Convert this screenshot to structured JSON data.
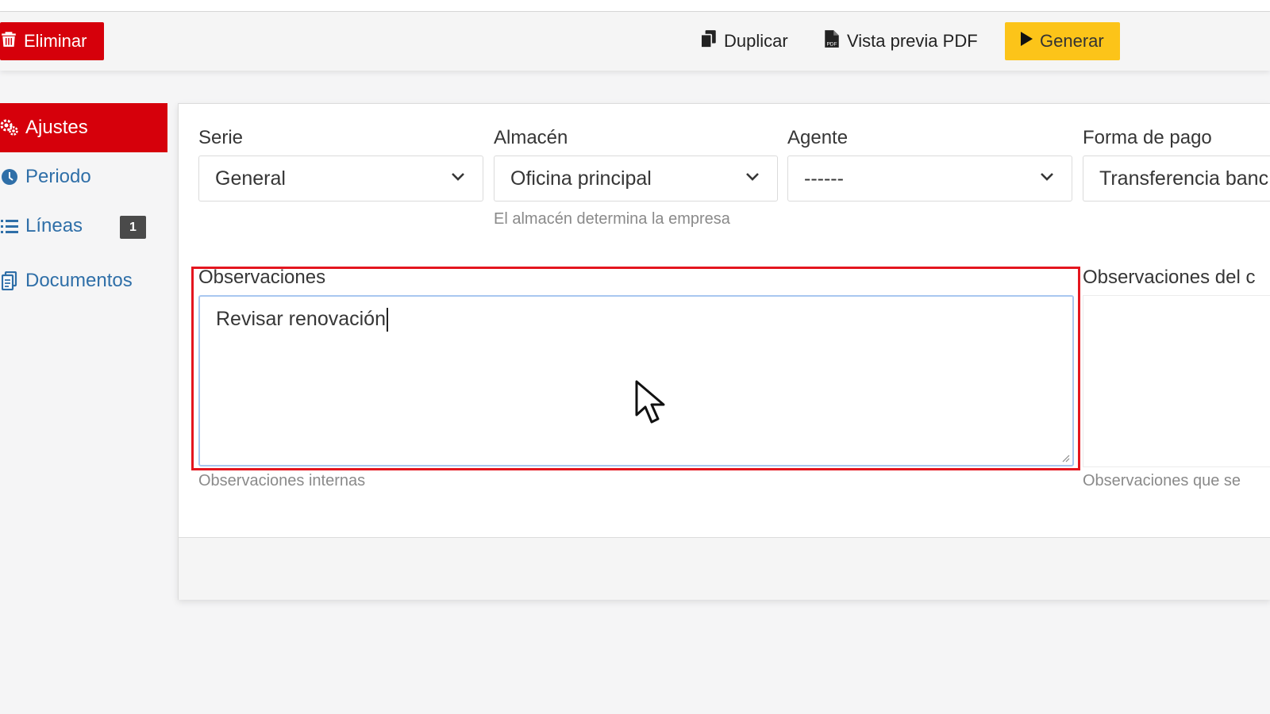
{
  "toolbar": {
    "delete_label": "Eliminar",
    "duplicate_label": "Duplicar",
    "pdf_label": "Vista previa PDF",
    "generate_label": "Generar"
  },
  "sidebar": {
    "items": [
      {
        "label": "Ajustes",
        "icon": "gears-icon",
        "active": true
      },
      {
        "label": "Periodo",
        "icon": "clock-icon"
      },
      {
        "label": "Líneas",
        "icon": "list-icon",
        "badge": "1"
      },
      {
        "label": "Documentos",
        "icon": "documents-icon"
      }
    ]
  },
  "form": {
    "serie": {
      "label": "Serie",
      "value": "General"
    },
    "almacen": {
      "label": "Almacén",
      "value": "Oficina principal",
      "help": "El almacén determina la empresa"
    },
    "agente": {
      "label": "Agente",
      "value": "------"
    },
    "forma_pago": {
      "label": "Forma de pago",
      "value": "Transferencia banc"
    },
    "observaciones": {
      "label": "Observaciones",
      "value": "Revisar renovación",
      "help": "Observaciones internas"
    },
    "observaciones_cliente": {
      "label": "Observaciones del c",
      "help": "Observaciones que se"
    }
  },
  "colors": {
    "delete": "#d6000b",
    "generate": "#fcc419",
    "active_sidebar": "#d6000b",
    "link": "#2f6fa8",
    "highlight": "#e4161f"
  }
}
